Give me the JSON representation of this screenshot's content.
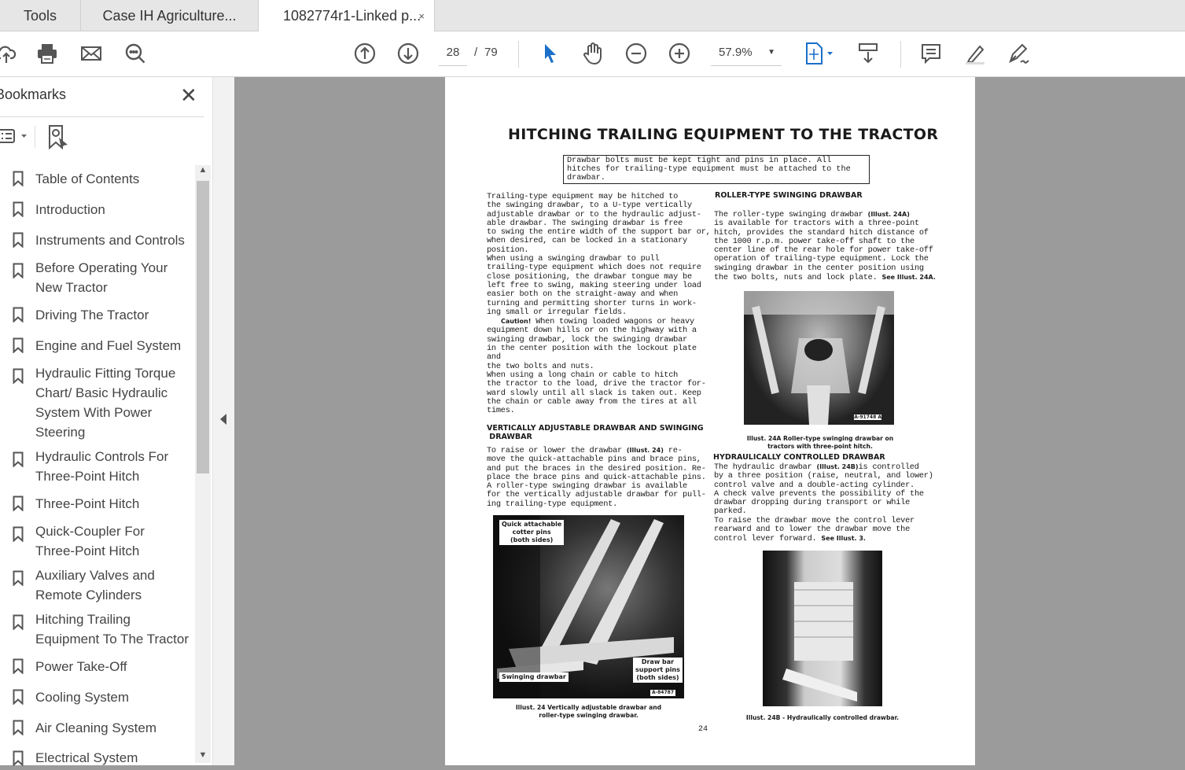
{
  "tabs": [
    {
      "label": "Tools"
    },
    {
      "label": "Case IH Agriculture..."
    },
    {
      "label": "1082774r1-Linked p...",
      "close": "×"
    }
  ],
  "toolbar": {
    "page_current": "28",
    "page_sep": "/",
    "page_total": "79",
    "zoom": "57.9%"
  },
  "bookmarks": {
    "title": "Bookmarks",
    "close": "✕",
    "items": [
      {
        "label": "Table of Contents"
      },
      {
        "label": "Introduction"
      },
      {
        "label": "Instruments and Controls"
      },
      {
        "label": "Before Operating Your\nNew Tractor"
      },
      {
        "label": "Driving The Tractor"
      },
      {
        "label": "Engine and Fuel System"
      },
      {
        "label": "Hydraulic Fitting Torque\nChart/ Basic Hydraulic\nSystem With Power\nSteering"
      },
      {
        "label": "Hydraulic Controls For\nThree-Point Hitch"
      },
      {
        "label": "Three-Point Hitch"
      },
      {
        "label": "Quick-Coupler For\nThree-Point Hitch"
      },
      {
        "label": "Auxiliary Valves and\nRemote Cylinders"
      },
      {
        "label": "Hitching Trailing\nEquipment To The Tractor"
      },
      {
        "label": "Power Take-Off"
      },
      {
        "label": "Cooling System"
      },
      {
        "label": "Air Cleaning System"
      },
      {
        "label": "Electrical System"
      }
    ]
  },
  "doc": {
    "title": "HITCHING TRAILING EQUIPMENT TO THE TRACTOR",
    "notice": "Drawbar bolts must be kept tight and pins in place. All hitches for trailing-type equipment must be attached to the drawbar.",
    "p1": "   Trailing-type equipment may be hitched to\nthe swinging drawbar, to a U-type vertically\nadjustable drawbar or to the hydraulic adjust-\nable drawbar. The swinging drawbar is free\nto swing the entire width of the support bar or,\nwhen desired, can be locked in a stationary\nposition.\n   When using a swinging drawbar to pull\ntrailing-type equipment which does not require\nclose positioning, the drawbar tongue may be\nleft free to swing, making steering under load\neasier both on the straight-away and when\nturning and permitting shorter turns in work-\ning small or irregular fields.",
    "caution_label": "Caution!",
    "p2": " When towing loaded wagons or heavy\nequipment down hills or on the highway with a\nswinging drawbar, lock the swinging drawbar\nin the center position with the lockout plate and\nthe two bolts and nuts.\n   When using a long chain or cable to hitch\nthe tractor to the load, drive the tractor for-\nward slowly until all slack is taken out. Keep\nthe chain or cable away from the tires at all\ntimes.",
    "h_vertical": "VERTICALLY ADJUSTABLE DRAWBAR AND SWINGING\n DRAWBAR",
    "p3a": "   To raise or lower the drawbar ",
    "p3ref": "(Illust. 24)",
    "p3b": " re-\nmove the quick-attachable pins and brace pins,\nand put the braces in the desired position. Re-\nplace the brace pins and quick-attachable pins.\nA roller-type swinging drawbar is available\nfor the vertically adjustable drawbar for pull-\ning trailing-type equipment.",
    "illus24": {
      "label_top": "Quick attachable\ncotter pins\n(both sides)",
      "label_left": "Swinging drawbar",
      "label_right": "Draw bar\nsupport pins\n(both sides)",
      "code": "A-84787",
      "caption": "Illust. 24 Vertically adjustable drawbar and\nroller-type swinging drawbar."
    },
    "h_roller": "ROLLER-TYPE SWINGING DRAWBAR",
    "p4a": "   The roller-type swinging drawbar ",
    "p4ref": "(Illust. 24A)",
    "p4b": "\nis available for tractors with a three-point\nhitch, provides the standard hitch distance of\nthe 1000 r.p.m. power take-off shaft to the\ncenter line of the rear hole for power take-off\noperation of trailing-type equipment. Lock the\nswinging drawbar in the center position using\nthe two bolts, nuts and lock plate. ",
    "p4see": "See Illust. 24A.",
    "illus24a": {
      "code": "A-91748 A",
      "caption": "Illust. 24A Roller-type swinging drawbar on\ntractors with three-point hitch."
    },
    "h_hyd": "HYDRAULICALLY CONTROLLED DRAWBAR",
    "p5a": "   The hydraulic drawbar ",
    "p5ref": "(Illust. 24B)",
    "p5b": "is controlled\nby a three position (raise, neutral, and lower)\ncontrol valve and a double-acting cylinder.\n   A check valve prevents the possibility of the\ndrawbar dropping during transport or while\nparked.\n   To raise the drawbar move the control lever\nrearward and to lower the drawbar move the\ncontrol lever forward. ",
    "p5see": "See Illust. 3.",
    "illus24b": {
      "caption": "Illust. 24B - Hydraulically controlled drawbar."
    },
    "page_number": "24"
  }
}
